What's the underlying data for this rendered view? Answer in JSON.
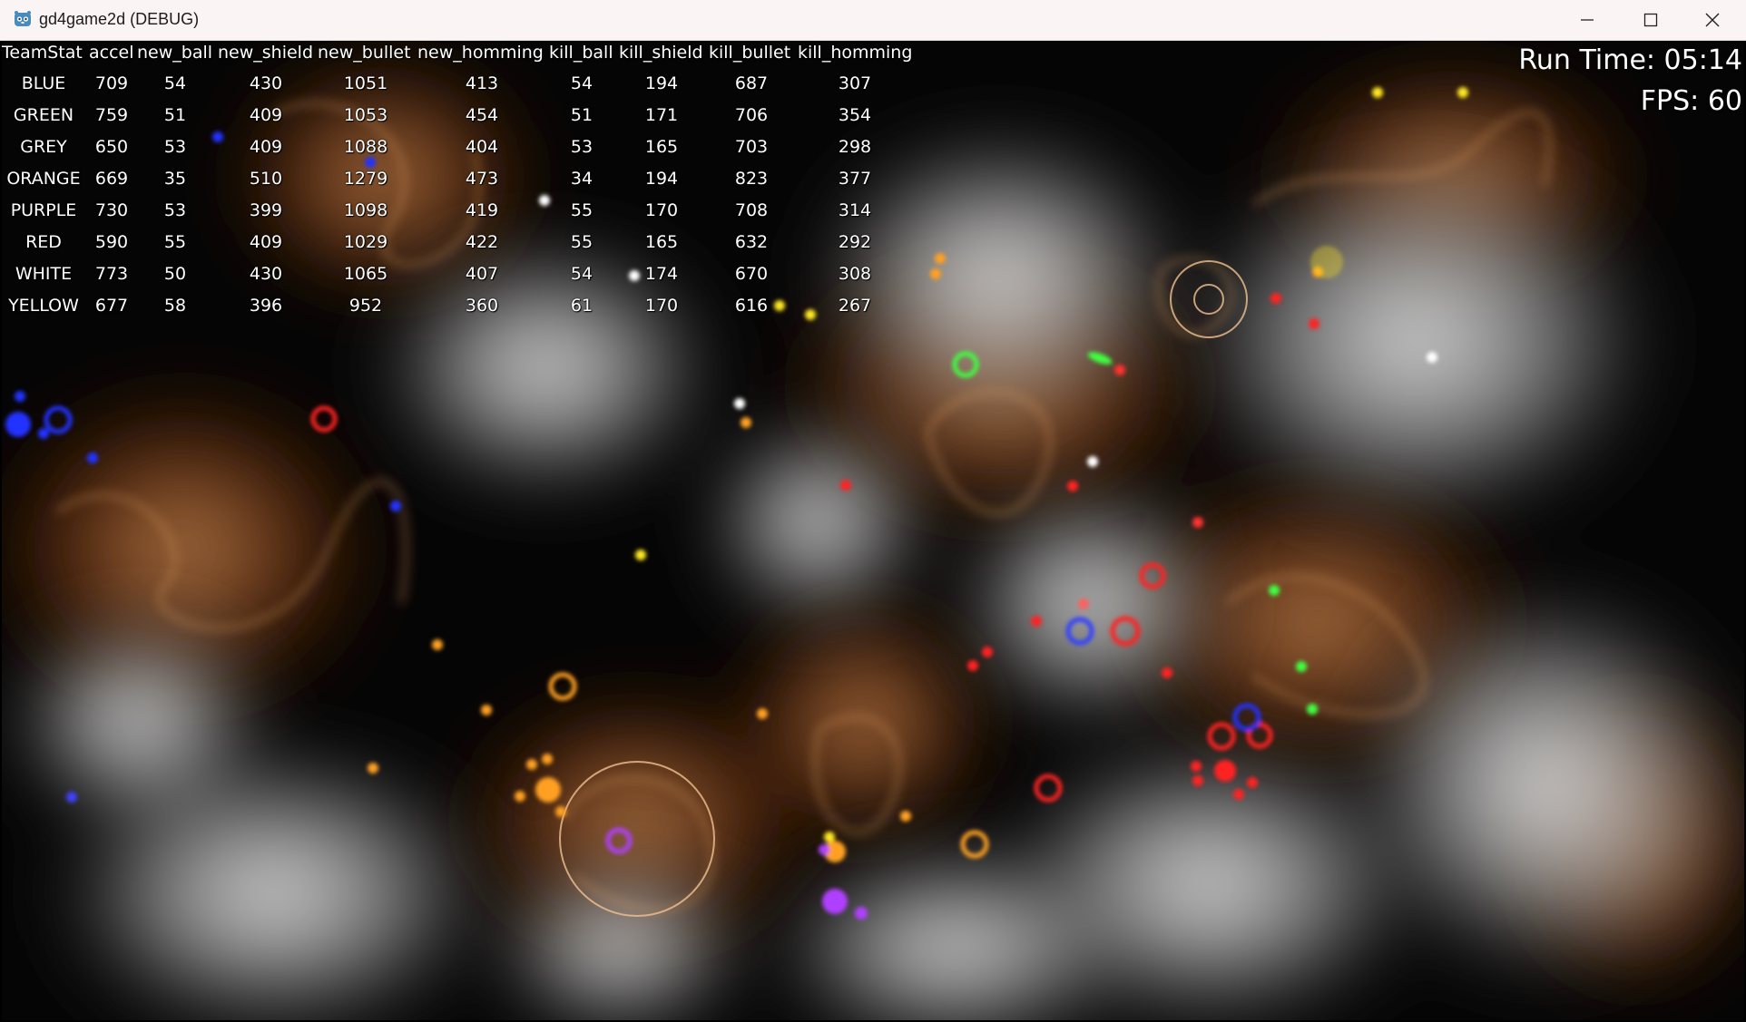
{
  "window": {
    "title": "gd4game2d (DEBUG)"
  },
  "stats": {
    "headers": [
      "TeamStat",
      "accel",
      "new_ball",
      "new_shield",
      "new_bullet",
      "new_homming",
      "kill_ball",
      "kill_shield",
      "kill_bullet",
      "kill_homming"
    ],
    "rows": [
      {
        "team": "BLUE",
        "values": [
          "709",
          "54",
          "430",
          "1051",
          "413",
          "54",
          "194",
          "687",
          "307"
        ]
      },
      {
        "team": "GREEN",
        "values": [
          "759",
          "51",
          "409",
          "1053",
          "454",
          "51",
          "171",
          "706",
          "354"
        ]
      },
      {
        "team": "GREY",
        "values": [
          "650",
          "53",
          "409",
          "1088",
          "404",
          "53",
          "165",
          "703",
          "298"
        ]
      },
      {
        "team": "ORANGE",
        "values": [
          "669",
          "35",
          "510",
          "1279",
          "473",
          "34",
          "194",
          "823",
          "377"
        ]
      },
      {
        "team": "PURPLE",
        "values": [
          "730",
          "53",
          "399",
          "1098",
          "419",
          "55",
          "170",
          "708",
          "314"
        ]
      },
      {
        "team": "RED",
        "values": [
          "590",
          "55",
          "409",
          "1029",
          "422",
          "55",
          "165",
          "632",
          "292"
        ]
      },
      {
        "team": "WHITE",
        "values": [
          "773",
          "50",
          "430",
          "1065",
          "407",
          "54",
          "174",
          "670",
          "308"
        ]
      },
      {
        "team": "YELLOW",
        "values": [
          "677",
          "58",
          "396",
          "952",
          "360",
          "61",
          "170",
          "616",
          "267"
        ]
      }
    ]
  },
  "hud": {
    "run_time": "Run Time: 05:14",
    "fps": "FPS: 60"
  },
  "colors": {
    "blue": "#1a2cff",
    "green": "#3cff3c",
    "grey": "#c8c8c8",
    "orange": "#ffa21a",
    "purple": "#b43cff",
    "red": "#ff1a1a",
    "white": "#ffffff",
    "yellow": "#ffe81a"
  }
}
